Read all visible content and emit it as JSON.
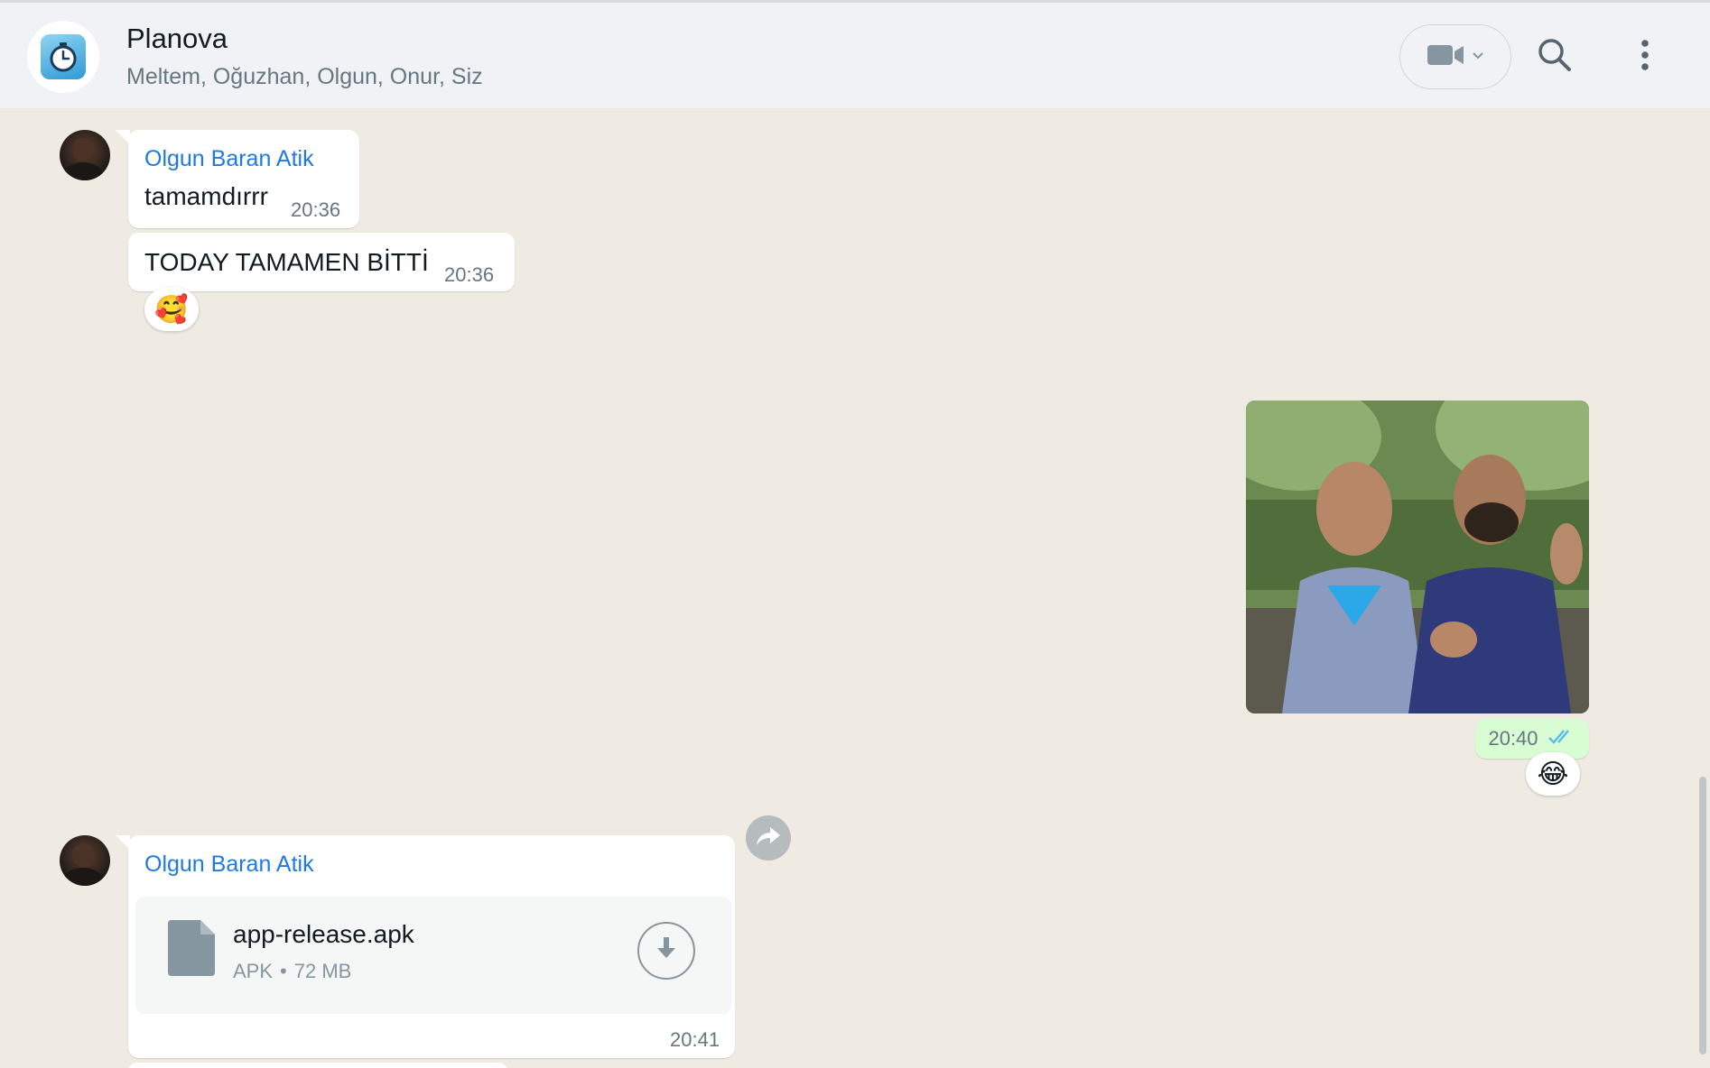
{
  "header": {
    "title": "Planova",
    "members": "Meltem, Oğuzhan, Olgun, Onur, Siz"
  },
  "messages": [
    {
      "sender": "Olgun Baran Atik",
      "text": "tamamdırrr",
      "time": "20:36"
    },
    {
      "text": "TODAY TAMAMEN BİTTİ",
      "time": "20:36",
      "reaction": "🥰"
    },
    {
      "outgoing": true,
      "type": "image",
      "time": "20:40",
      "status": "read",
      "reaction": "😂"
    },
    {
      "sender": "Olgun Baran Atik",
      "type": "file",
      "file_name": "app-release.apk",
      "file_type": "APK",
      "file_size": "72 MB",
      "time": "20:41"
    }
  ],
  "colors": {
    "sender_name": "#1f7ae0",
    "outgoing_bubble": "#d9fdd3",
    "read_ticks": "#53bdeb",
    "chat_background": "#efeae2"
  },
  "icons": [
    "video-call-icon",
    "chevron-down-icon",
    "search-icon",
    "menu-dots-icon",
    "file-icon",
    "download-icon",
    "forward-icon",
    "double-check-icon"
  ]
}
